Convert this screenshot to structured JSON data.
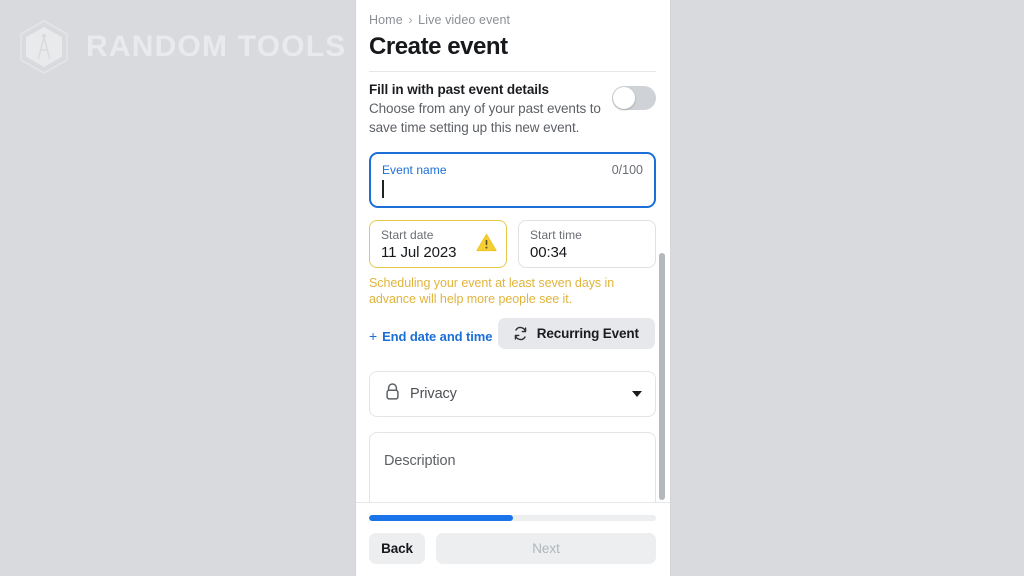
{
  "brand": {
    "name": "RANDOM TOOLS",
    "logo_icon": "hexagon-compass-icon",
    "wordmark_color": "#e9eaec",
    "background_color": "#d8dadd"
  },
  "panel": {
    "background_color": "#ffffff",
    "breadcrumb": {
      "home": "Home",
      "separator": "›",
      "current": "Live video event"
    },
    "page_title": "Create event",
    "past_event": {
      "title": "Fill in with past event details",
      "description": "Choose from any of your past events to save time setting up this new event.",
      "toggle_state": "off",
      "toggle_track_color": "#cfd2d6"
    },
    "event_name": {
      "label": "Event name",
      "value": "",
      "counter": "0/100",
      "focused": true,
      "focus_color": "#1c6fd6"
    },
    "start_date": {
      "label": "Start date",
      "value": "11 Jul 2023",
      "has_warning": true,
      "warning_icon": "warning-triangle-icon",
      "border_color": "#e6c84d"
    },
    "start_time": {
      "label": "Start time",
      "value": "00:34"
    },
    "warning_message": "Scheduling your event at least seven days in advance will help more people see it.",
    "warning_color": "#e0b43c",
    "end_date_link": {
      "plus": "+",
      "label": "End date and time",
      "color": "#1c6fd6"
    },
    "recurring_button": {
      "label": "Recurring Event",
      "icon": "refresh-sync-icon"
    },
    "privacy": {
      "label": "Privacy",
      "icon": "lock-icon",
      "chevron": "chevron-down-icon"
    },
    "description": {
      "placeholder": "Description",
      "value": ""
    },
    "scrollbar": {
      "thumb_color": "#b4b7bb"
    }
  },
  "footer": {
    "progress_percent": 50,
    "progress_fill_color": "#1a73e8",
    "progress_track_color": "#eceef0",
    "back_label": "Back",
    "next_label": "Next",
    "next_disabled": true
  }
}
